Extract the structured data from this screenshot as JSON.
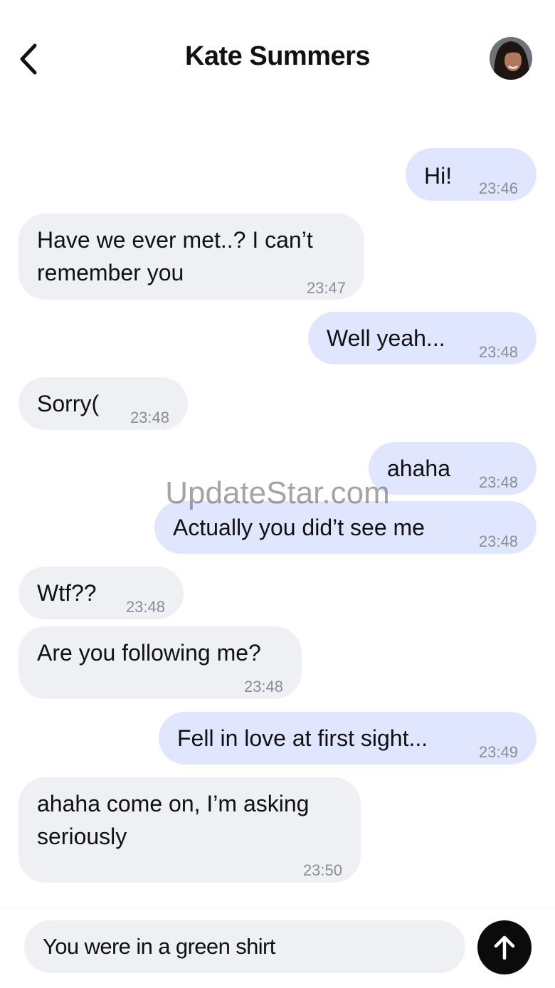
{
  "header": {
    "title": "Kate Summers",
    "back_icon": "chevron-left-icon",
    "avatar_icon": "profile-photo"
  },
  "messages": [
    {
      "direction": "outgoing",
      "text": "Hi!",
      "time": "23:46"
    },
    {
      "direction": "incoming",
      "text_lines": [
        "Have we ever met..? I can’t",
        "remember you"
      ],
      "time": "23:47"
    },
    {
      "direction": "outgoing",
      "text": "Well yeah...",
      "time": "23:48"
    },
    {
      "direction": "incoming",
      "text": "Sorry(",
      "time": "23:48"
    },
    {
      "direction": "outgoing",
      "text": "ahaha",
      "time": "23:48"
    },
    {
      "direction": "outgoing",
      "text": "Actually you did’t see me",
      "time": "23:48"
    },
    {
      "direction": "incoming",
      "text": "Wtf??",
      "time": "23:48"
    },
    {
      "direction": "incoming",
      "text": "Are you following me?",
      "time": "23:48"
    },
    {
      "direction": "outgoing",
      "text": "Fell in love at first sight...",
      "time": "23:49"
    },
    {
      "direction": "incoming",
      "text_lines": [
        "ahaha come on, I’m asking",
        "seriously"
      ],
      "time": "23:50"
    }
  ],
  "composer": {
    "value": "You were in a green shirt",
    "send_icon": "arrow-up-icon"
  },
  "watermark": "UpdateStar.com",
  "colors": {
    "outgoing_bubble": "#e1e6ff",
    "incoming_bubble": "#eef0f4",
    "timestamp": "#8c8c92",
    "send_button": "#0b0b0b"
  }
}
